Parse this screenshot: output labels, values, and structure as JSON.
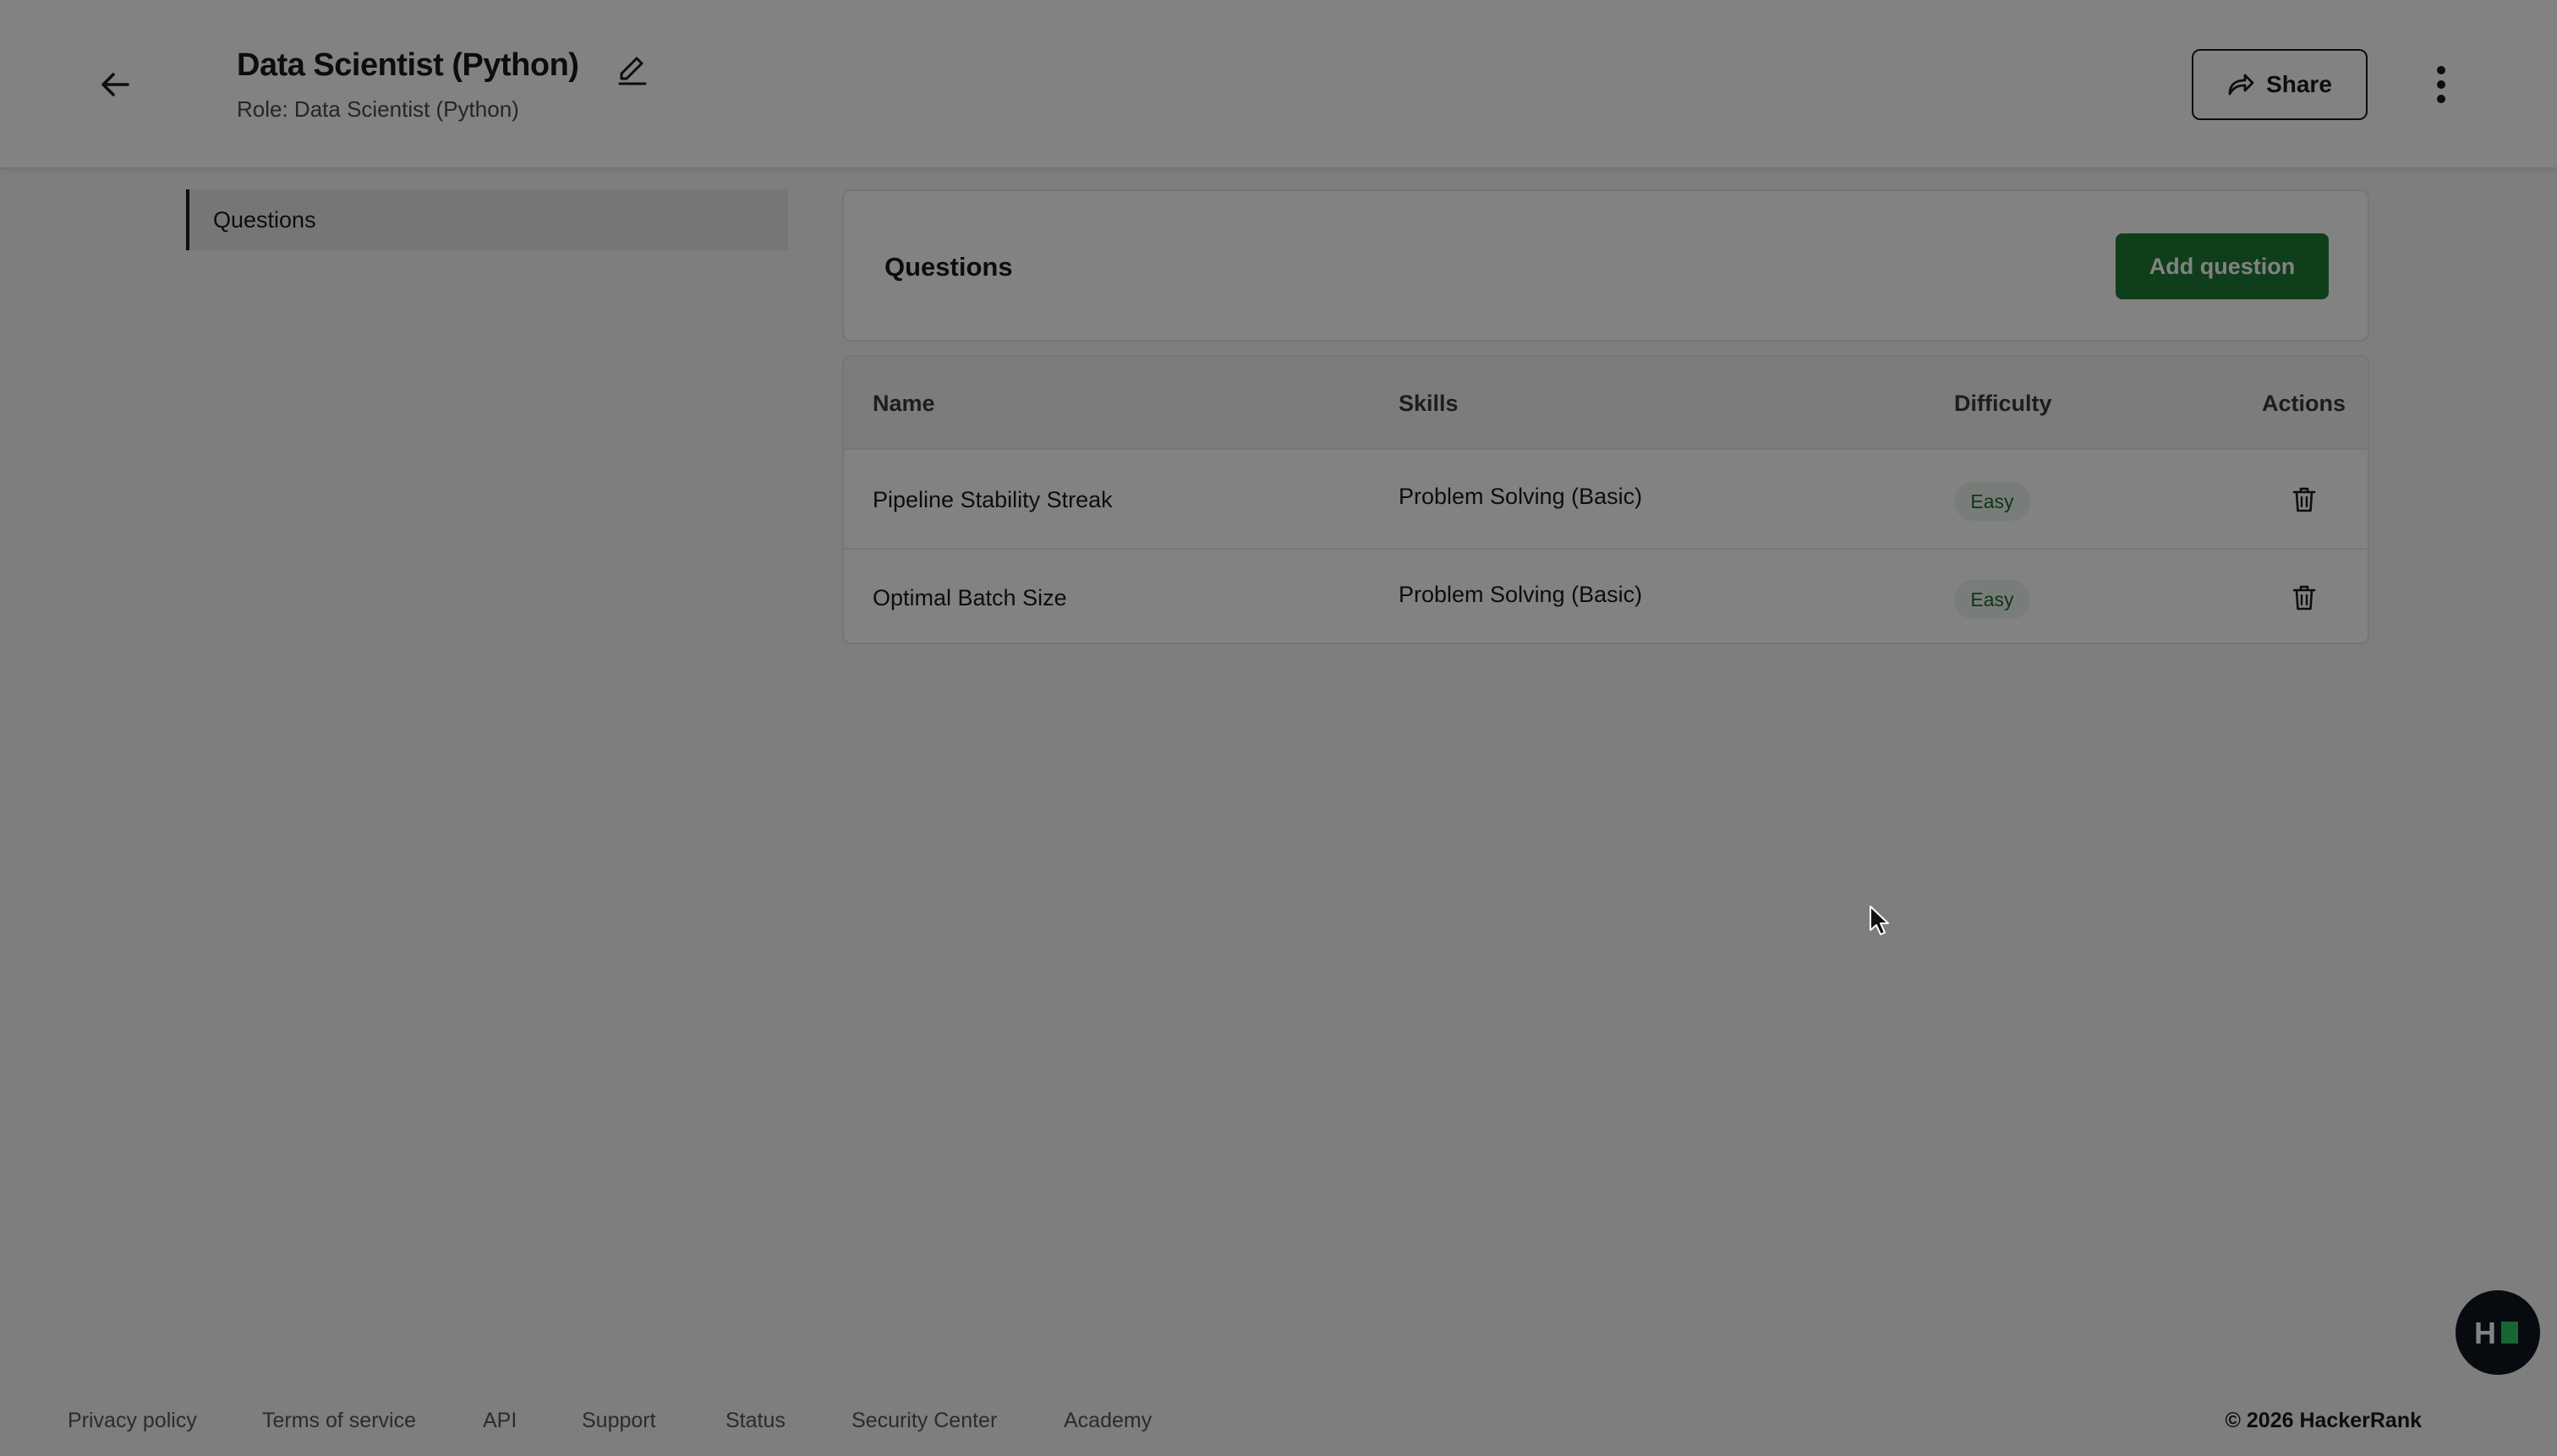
{
  "header": {
    "title": "Data Scientist (Python)",
    "subtitle": "Role: Data Scientist (Python)",
    "share_label": "Share"
  },
  "sidebar": {
    "items": [
      {
        "label": "Questions",
        "active": true
      }
    ]
  },
  "questions_panel": {
    "title": "Questions",
    "add_label": "Add question"
  },
  "table": {
    "columns": [
      "Name",
      "Skills",
      "Difficulty",
      "Actions"
    ],
    "rows": [
      {
        "name": "Pipeline Stability Streak",
        "skills": "Problem Solving (Basic)",
        "difficulty": "Easy"
      },
      {
        "name": "Optimal Batch Size",
        "skills": "Problem Solving (Basic)",
        "difficulty": "Easy"
      }
    ]
  },
  "footer": {
    "links": [
      "Privacy policy",
      "Terms of service",
      "API",
      "Support",
      "Status",
      "Security Center",
      "Academy"
    ],
    "copyright": "© 2026 HackerRank"
  },
  "help_bubble": {
    "letter": "H"
  },
  "colors": {
    "accent_green": "#1e7a35",
    "badge_bg": "#eef5ee",
    "badge_text": "#1e6b30",
    "overlay": "rgba(0,0,0,0.49)"
  },
  "icons": {
    "back": "arrow-left-icon",
    "edit": "pencil-icon",
    "share": "share-arrow-icon",
    "more": "kebab-menu-icon",
    "delete": "trash-icon",
    "help": "hackerrank-logo-icon"
  }
}
